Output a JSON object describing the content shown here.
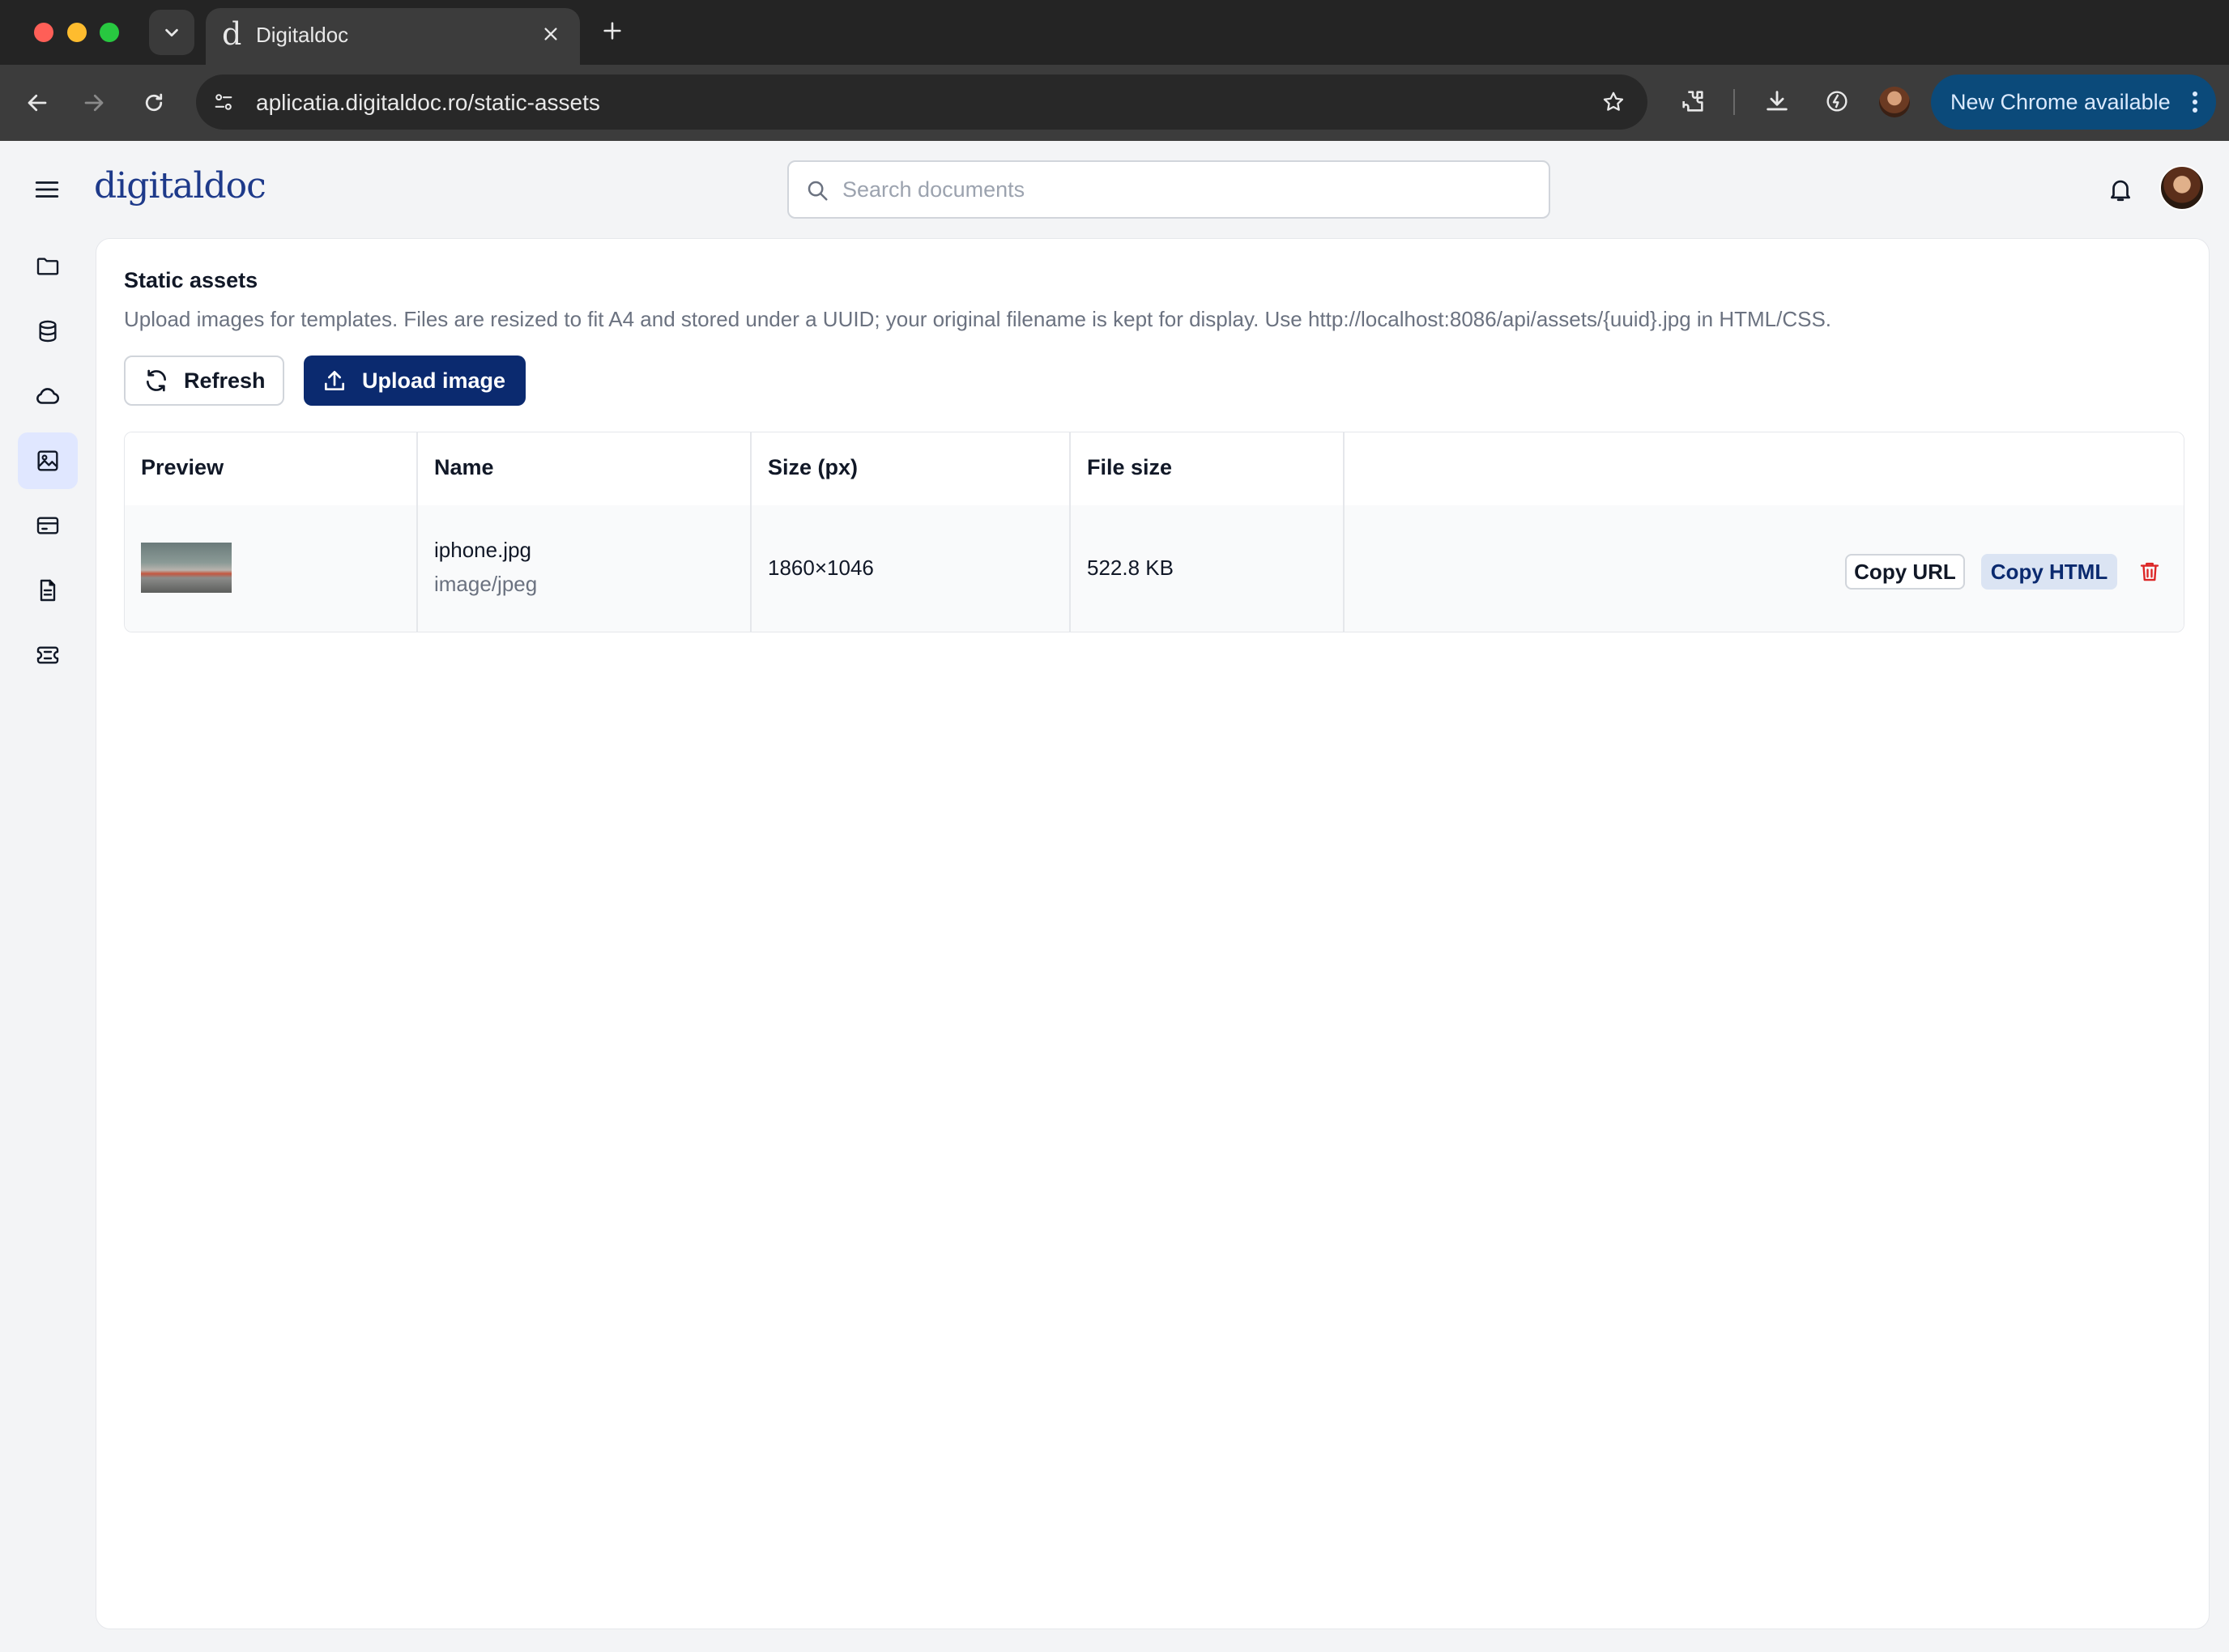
{
  "browser": {
    "tab_title": "Digitaldoc",
    "tab_favicon": "d",
    "url": "aplicatia.digitaldoc.ro/static-assets",
    "update_label": "New Chrome available"
  },
  "header": {
    "logo": "digitaldoc",
    "search_placeholder": "Search documents"
  },
  "sidebar": {
    "items": [
      {
        "icon": "folder-icon"
      },
      {
        "icon": "database-icon"
      },
      {
        "icon": "cloud-icon"
      },
      {
        "icon": "image-icon",
        "active": true
      },
      {
        "icon": "card-icon"
      },
      {
        "icon": "document-icon"
      },
      {
        "icon": "ticket-icon"
      }
    ]
  },
  "page": {
    "title": "Static assets",
    "description": "Upload images for templates. Files are resized to fit A4 and stored under a UUID; your original filename is kept for display. Use http://localhost:8086/api/assets/{uuid}.jpg in HTML/CSS.",
    "refresh_label": "Refresh",
    "upload_label": "Upload image"
  },
  "table": {
    "columns": [
      "Preview",
      "Name",
      "Size (px)",
      "File size"
    ],
    "rows": [
      {
        "name": "iphone.jpg",
        "mime": "image/jpeg",
        "dimensions": "1860×1046",
        "file_size": "522.8 KB",
        "copy_url_label": "Copy URL",
        "copy_html_label": "Copy HTML"
      }
    ]
  },
  "colors": {
    "accent": "#0b2a6f",
    "delete": "#dc2626",
    "active_sidebar_bg": "#e0e7ff"
  }
}
